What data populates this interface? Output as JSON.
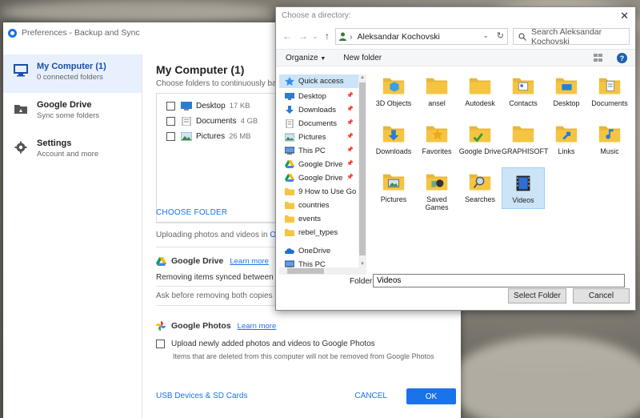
{
  "window": {
    "title": "Preferences - Backup and Sync",
    "sidebar": [
      {
        "title": "My Computer (1)",
        "subtitle": "0 connected folders",
        "icon": "monitor-icon"
      },
      {
        "title": "Google Drive",
        "subtitle": "Sync some folders",
        "icon": "drive-folder-icon"
      },
      {
        "title": "Settings",
        "subtitle": "Account and more",
        "icon": "gear-icon"
      }
    ],
    "main": {
      "title": "My Computer (1)",
      "subtitle": "Choose folders to continuously back up",
      "folders": [
        {
          "name": "Desktop",
          "size": "17 KB"
        },
        {
          "name": "Documents",
          "size": "4 GB"
        },
        {
          "name": "Pictures",
          "size": "26 MB"
        }
      ],
      "choose_folder": "CHOOSE FOLDER",
      "upload_note": "Uploading photos and videos in",
      "upload_link": "Origin",
      "drive_section": "Google Drive",
      "drive_learn": "Learn more",
      "drive_removing": "Removing items synced between Goo",
      "drive_ask": "Ask before removing both copies",
      "photos_section": "Google Photos",
      "photos_learn": "Learn more",
      "photos_checkbox": "Upload newly added photos and videos to Google Photos",
      "photos_note": "Items that are deleted from this computer will not be removed from Google Photos"
    },
    "footer": {
      "usb": "USB Devices & SD Cards",
      "cancel": "CANCEL",
      "ok": "OK"
    }
  },
  "dialog": {
    "title": "Choose a directory:",
    "address": "Aleksandar Kochovski",
    "search_placeholder": "Search Aleksandar Kochovski",
    "organize": "Organize",
    "new_folder": "New folder",
    "nav": [
      {
        "label": "Quick access",
        "icon": "star-icon",
        "pinned": false
      },
      {
        "label": "Desktop",
        "icon": "desktop-icon",
        "pinned": true
      },
      {
        "label": "Downloads",
        "icon": "download-icon",
        "pinned": true
      },
      {
        "label": "Documents",
        "icon": "documents-icon",
        "pinned": true
      },
      {
        "label": "Pictures",
        "icon": "pictures-icon",
        "pinned": true
      },
      {
        "label": "This PC",
        "icon": "pc-icon",
        "pinned": true
      },
      {
        "label": "Google Drive",
        "icon": "google-drive-icon",
        "pinned": true
      },
      {
        "label": "Google Drive",
        "icon": "google-drive-icon",
        "pinned": true
      },
      {
        "label": "9 How to Use Go",
        "icon": "folder-icon",
        "pinned": false
      },
      {
        "label": "countries",
        "icon": "folder-icon",
        "pinned": false
      },
      {
        "label": "events",
        "icon": "folder-icon",
        "pinned": false
      },
      {
        "label": "rebel_types",
        "icon": "folder-icon",
        "pinned": false
      },
      {
        "label": "OneDrive",
        "icon": "onedrive-icon",
        "pinned": false
      },
      {
        "label": "This PC",
        "icon": "pc-icon",
        "pinned": false
      }
    ],
    "items": [
      {
        "label": "3D Objects",
        "icon": "3d-objects-folder-icon"
      },
      {
        "label": "ansel",
        "icon": "folder-icon"
      },
      {
        "label": "Autodesk",
        "icon": "folder-icon"
      },
      {
        "label": "Contacts",
        "icon": "contacts-folder-icon"
      },
      {
        "label": "Desktop",
        "icon": "desktop-folder-icon"
      },
      {
        "label": "Documents",
        "icon": "documents-folder-icon"
      },
      {
        "label": "Downloads",
        "icon": "downloads-folder-icon"
      },
      {
        "label": "Favorites",
        "icon": "favorites-folder-icon"
      },
      {
        "label": "Google Drive",
        "icon": "google-drive-folder-icon"
      },
      {
        "label": "GRAPHISOFT",
        "icon": "folder-icon"
      },
      {
        "label": "Links",
        "icon": "links-folder-icon"
      },
      {
        "label": "Music",
        "icon": "music-folder-icon"
      },
      {
        "label": "Pictures",
        "icon": "pictures-folder-icon"
      },
      {
        "label": "Saved Games",
        "icon": "saved-games-folder-icon"
      },
      {
        "label": "Searches",
        "icon": "searches-folder-icon"
      },
      {
        "label": "Videos",
        "icon": "videos-folder-icon",
        "selected": true
      }
    ],
    "folder_label": "Folder:",
    "folder_value": "Videos",
    "select_button": "Select Folder",
    "cancel_button": "Cancel"
  },
  "colors": {
    "accent": "#1a73e8",
    "selection": "#cce4f7",
    "folder": "#f5c542"
  }
}
